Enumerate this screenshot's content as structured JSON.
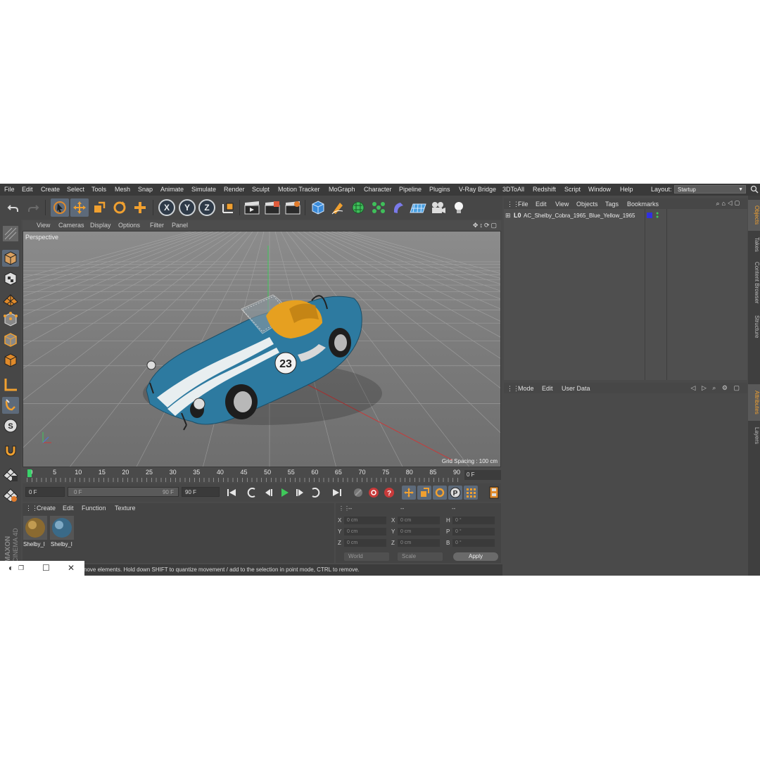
{
  "menubar": {
    "items": [
      "File",
      "Edit",
      "Create",
      "Select",
      "Tools",
      "Mesh",
      "Snap",
      "Animate",
      "Simulate",
      "Render",
      "Sculpt",
      "Motion Tracker",
      "MoGraph",
      "Character",
      "Pipeline",
      "Plugins",
      "V-Ray Bridge",
      "3DToAll",
      "Redshift",
      "Script",
      "Window",
      "Help"
    ],
    "layout_label": "Layout:",
    "layout_value": "Startup"
  },
  "toolbar": {
    "axis_x": "X",
    "axis_y": "Y",
    "axis_z": "Z"
  },
  "viewport": {
    "menu": [
      "View",
      "Cameras",
      "Display",
      "Options",
      "Filter",
      "Panel"
    ],
    "camera_label": "Perspective",
    "grid_spacing": "Grid Spacing : 100 cm",
    "car_number": "23"
  },
  "timeline": {
    "ticks": [
      "0",
      "5",
      "10",
      "15",
      "20",
      "25",
      "30",
      "35",
      "40",
      "45",
      "50",
      "55",
      "60",
      "65",
      "70",
      "75",
      "80",
      "85",
      "90"
    ],
    "end_field": "0 F"
  },
  "transport": {
    "start_frame": "0 F",
    "range_start": "0 F",
    "range_end": "90 F",
    "end_frame": "90 F"
  },
  "materials": {
    "menu": [
      "Create",
      "Edit",
      "Function",
      "Texture"
    ],
    "items": [
      {
        "label": "Shelby_l"
      },
      {
        "label": "Shelby_l"
      }
    ]
  },
  "coordinates": {
    "header": [
      "--",
      "--",
      "--"
    ],
    "rows": [
      {
        "l1": "X",
        "v1": "0 cm",
        "l2": "X",
        "v2": "0 cm",
        "l3": "H",
        "v3": "0 °"
      },
      {
        "l1": "Y",
        "v1": "0 cm",
        "l2": "Y",
        "v2": "0 cm",
        "l3": "P",
        "v3": "0 °"
      },
      {
        "l1": "Z",
        "v1": "0 cm",
        "l2": "Z",
        "v2": "0 cm",
        "l3": "B",
        "v3": "0 °"
      }
    ],
    "mode_world": "World",
    "mode_scale": "Scale",
    "apply_label": "Apply"
  },
  "status": {
    "text": "nove elements. Hold down SHIFT to quantize movement / add to the selection in point mode, CTRL to remove."
  },
  "branding": {
    "maxon": "MAXON",
    "cinema": "CINEMA 4D"
  },
  "object_manager": {
    "menu": [
      "File",
      "Edit",
      "View",
      "Objects",
      "Tags",
      "Bookmarks"
    ],
    "object_name": "AC_Shelby_Cobra_1965_Blue_Yellow_1965"
  },
  "attributes_manager": {
    "menu": [
      "Mode",
      "Edit",
      "User Data"
    ]
  },
  "right_tabs": {
    "top": [
      "Objects",
      "Takes",
      "Content Browser",
      "Structure"
    ],
    "bottom": [
      "Attributes",
      "Layers"
    ]
  },
  "colors": {
    "ui_bg": "#4a4a4a",
    "accent_orange": "#f0a030",
    "car_blue": "#2d7aa0",
    "seat_yellow": "#e6a020",
    "axis_green": "#3fc85a",
    "axis_red": "#c83a3a",
    "timeline_marker": "#39d36a"
  }
}
